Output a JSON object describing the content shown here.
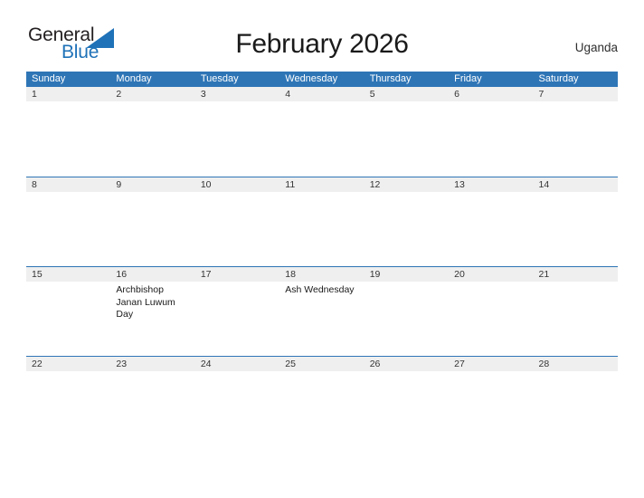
{
  "brand": {
    "name_line1": "General",
    "name_line2": "Blue",
    "flag_icon": "blue-triangle-flag-icon",
    "accent_color": "#1f72b8"
  },
  "header": {
    "title": "February 2026",
    "region": "Uganda"
  },
  "colors": {
    "header_blue": "#2e75b6",
    "date_band_gray": "#efefef",
    "text_dark": "#1a1a1a"
  },
  "calendar": {
    "month": "February",
    "year": "2026",
    "weekday_headers": [
      "Sunday",
      "Monday",
      "Tuesday",
      "Wednesday",
      "Thursday",
      "Friday",
      "Saturday"
    ],
    "weeks": [
      {
        "days": [
          {
            "number": "1",
            "events": []
          },
          {
            "number": "2",
            "events": []
          },
          {
            "number": "3",
            "events": []
          },
          {
            "number": "4",
            "events": []
          },
          {
            "number": "5",
            "events": []
          },
          {
            "number": "6",
            "events": []
          },
          {
            "number": "7",
            "events": []
          }
        ]
      },
      {
        "days": [
          {
            "number": "8",
            "events": []
          },
          {
            "number": "9",
            "events": []
          },
          {
            "number": "10",
            "events": []
          },
          {
            "number": "11",
            "events": []
          },
          {
            "number": "12",
            "events": []
          },
          {
            "number": "13",
            "events": []
          },
          {
            "number": "14",
            "events": []
          }
        ]
      },
      {
        "days": [
          {
            "number": "15",
            "events": []
          },
          {
            "number": "16",
            "events": [
              "Archbishop Janan Luwum Day"
            ]
          },
          {
            "number": "17",
            "events": []
          },
          {
            "number": "18",
            "events": [
              "Ash Wednesday"
            ]
          },
          {
            "number": "19",
            "events": []
          },
          {
            "number": "20",
            "events": []
          },
          {
            "number": "21",
            "events": []
          }
        ]
      },
      {
        "days": [
          {
            "number": "22",
            "events": []
          },
          {
            "number": "23",
            "events": []
          },
          {
            "number": "24",
            "events": []
          },
          {
            "number": "25",
            "events": []
          },
          {
            "number": "26",
            "events": []
          },
          {
            "number": "27",
            "events": []
          },
          {
            "number": "28",
            "events": []
          }
        ]
      }
    ]
  }
}
